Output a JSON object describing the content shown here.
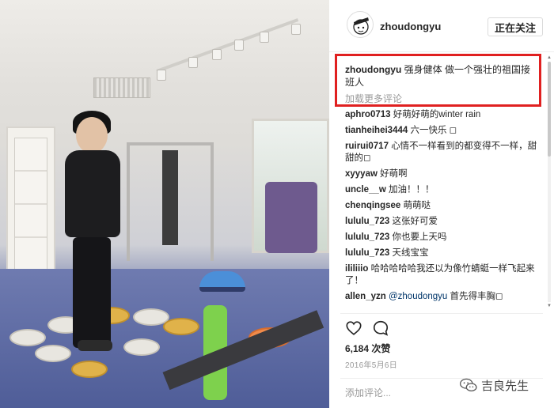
{
  "post": {
    "username": "zhoudongyu",
    "follow_label": "正在关注"
  },
  "caption": {
    "username": "zhoudongyu",
    "text": "强身健体 做一个强壮的祖国接班人"
  },
  "load_more_label": "加载更多评论",
  "comments": [
    {
      "user": "aphro0713",
      "text": "好萌好萌的winter rain"
    },
    {
      "user": "tianheihei3444",
      "text": "六一快乐 ◻"
    },
    {
      "user": "ruirui0717",
      "text": "心情不一样看到的都变得不一样，甜甜的◻"
    },
    {
      "user": "xyyyaw",
      "text": "好萌啊"
    },
    {
      "user": "uncle__w",
      "text": "加油！！！"
    },
    {
      "user": "chenqingsee",
      "text": "萌萌哒"
    },
    {
      "user": "lululu_723",
      "text": "这张好可爱"
    },
    {
      "user": "lululu_723",
      "text": "你也要上天吗"
    },
    {
      "user": "lululu_723",
      "text": "天线宝宝"
    },
    {
      "user": "ililiiio",
      "text": "哈哈哈哈哈我还以为像竹蜻蜓一样飞起来了！"
    },
    {
      "user": "allen_yzn",
      "mention": "@zhoudongyu",
      "text": " 首先得丰胸◻"
    }
  ],
  "icons": {
    "like": "heart-outline-icon",
    "comment": "speech-bubble-icon",
    "watermark": "wechat-icon"
  },
  "likes_label": "6,184 次赞",
  "date_label": "2016年5月6日",
  "comment_input_placeholder": "添加评论...",
  "watermark_text": "吉良先生",
  "colors": {
    "highlight_border": "#e02020",
    "mention": "#003569",
    "muted": "#999999"
  }
}
